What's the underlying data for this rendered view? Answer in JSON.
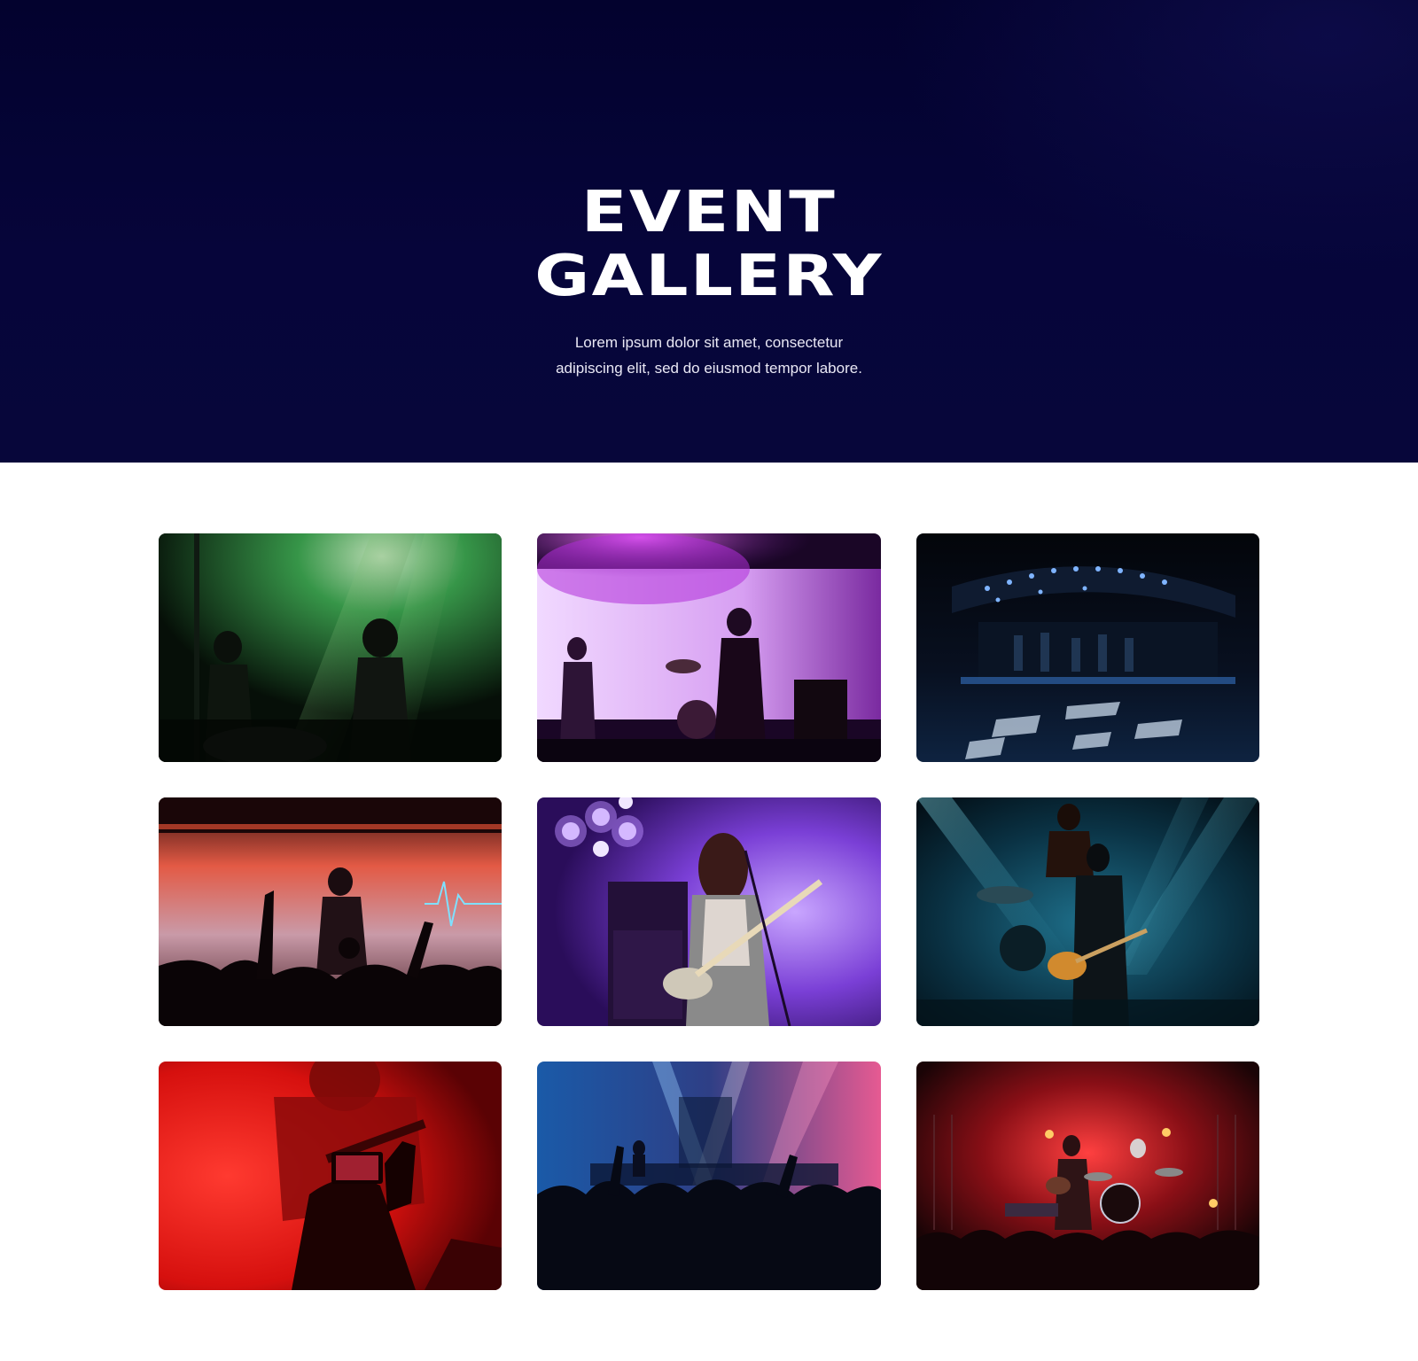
{
  "hero": {
    "title_line1": "EVENT",
    "title_line2": "GALLERY",
    "subtitle_line1": "Lorem ipsum dolor sit amet, consectetur",
    "subtitle_line2": "adipiscing elit, sed do eiusmod tempor labore."
  },
  "gallery": {
    "photos": [
      {
        "subject": "guitarists-green-stage-lights",
        "colors": [
          "#0a140c",
          "#4fd17a"
        ]
      },
      {
        "subject": "band-purple-stage-screen",
        "colors": [
          "#2a0a3a",
          "#e7c6f7"
        ]
      },
      {
        "subject": "outdoor-stage-blue-lights",
        "colors": [
          "#04060c",
          "#3d7bd8"
        ]
      },
      {
        "subject": "guitarist-crowd-red-stage",
        "colors": [
          "#1a0608",
          "#e94b3c"
        ]
      },
      {
        "subject": "bassist-singer-purple-lights",
        "colors": [
          "#2b0f5c",
          "#b67cf2"
        ]
      },
      {
        "subject": "guitarist-drummer-teal-lights",
        "colors": [
          "#031822",
          "#2bb6d6"
        ]
      },
      {
        "subject": "phone-recording-red-concert",
        "colors": [
          "#3a0204",
          "#ff2a22"
        ]
      },
      {
        "subject": "crowd-blue-pink-stage",
        "colors": [
          "#050a1c",
          "#e04e8e"
        ]
      },
      {
        "subject": "band-red-stage-crowd",
        "colors": [
          "#140406",
          "#ff3030"
        ]
      }
    ]
  }
}
